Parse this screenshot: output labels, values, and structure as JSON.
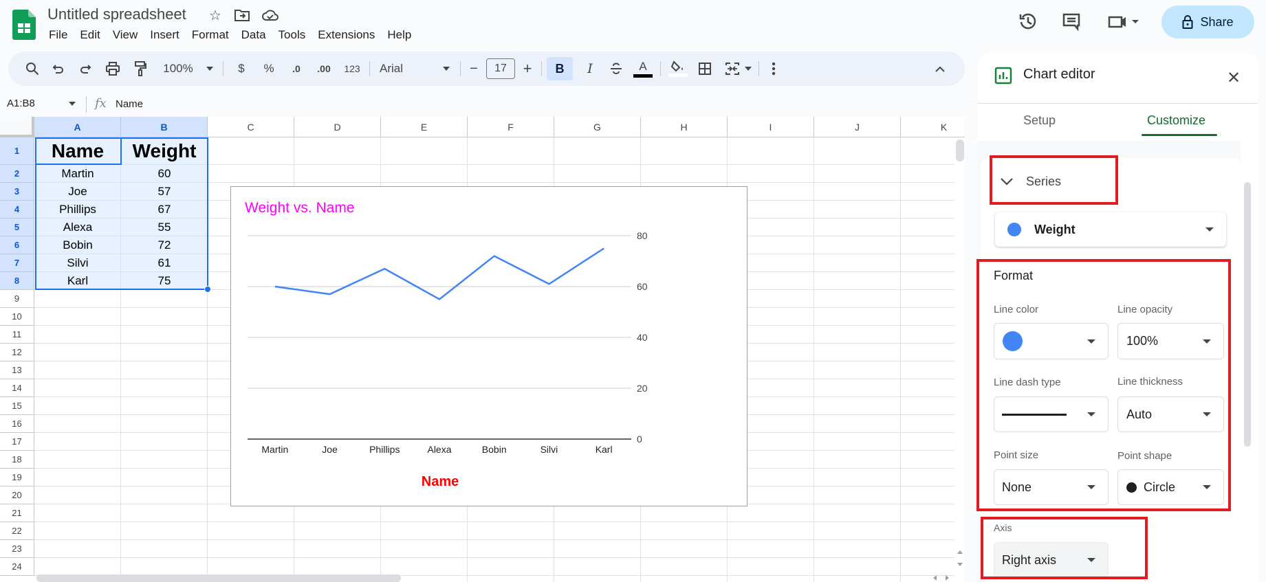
{
  "app": {
    "title": "Untitled spreadsheet",
    "brand_color": "#0f9d58",
    "menu": [
      "File",
      "Edit",
      "View",
      "Insert",
      "Format",
      "Data",
      "Tools",
      "Extensions",
      "Help"
    ],
    "share_label": "Share",
    "title_icons": [
      "star-icon",
      "move-to-folder-icon",
      "cloud-saved-icon"
    ],
    "header_icons": [
      "version-history-icon",
      "comments-icon",
      "meet-icon"
    ]
  },
  "toolbar": {
    "zoom": "100%",
    "currency": "$",
    "percent": "%",
    "decrease_decimal": ".0",
    "increase_decimal": ".00",
    "more_formats": "123",
    "font": "Arial",
    "font_size": "17",
    "decrement": "−",
    "increment": "+",
    "bold": "B",
    "italic": "I",
    "strikethrough": "S",
    "text_color": "A"
  },
  "formula_bar": {
    "name_box": "A1:B8",
    "fx": "fx",
    "content": "Name"
  },
  "sheet": {
    "columns": [
      "A",
      "B",
      "C",
      "D",
      "E",
      "F",
      "G",
      "H",
      "I",
      "J",
      "K"
    ],
    "rows": [
      "1",
      "2",
      "3",
      "4",
      "5",
      "6",
      "7",
      "8",
      "9",
      "10",
      "11",
      "12",
      "13",
      "14",
      "15",
      "16",
      "17",
      "18",
      "19",
      "20",
      "21",
      "22",
      "23",
      "24"
    ],
    "header": [
      "Name",
      "Weight"
    ],
    "data": [
      [
        "Martin",
        "60"
      ],
      [
        "Joe",
        "57"
      ],
      [
        "Phillips",
        "67"
      ],
      [
        "Alexa",
        "55"
      ],
      [
        "Bobin",
        "72"
      ],
      [
        "Silvi",
        "61"
      ],
      [
        "Karl",
        "75"
      ]
    ]
  },
  "chart_data": {
    "type": "line",
    "title": "Weight vs. Name",
    "title_color": "#ff00ff",
    "xlabel": "Name",
    "xlabel_color": "#ff0000",
    "ylabel": "",
    "categories": [
      "Martin",
      "Joe",
      "Phillips",
      "Alexa",
      "Bobin",
      "Silvi",
      "Karl"
    ],
    "series": [
      {
        "name": "Weight",
        "color": "#4285f4",
        "values": [
          60,
          57,
          67,
          55,
          72,
          61,
          75
        ]
      }
    ],
    "ylim": [
      0,
      80
    ],
    "yticks": [
      "0",
      "20",
      "40",
      "60",
      "80"
    ],
    "y_axis_side": "right",
    "grid": true,
    "legend": "none"
  },
  "chart_editor": {
    "title": "Chart editor",
    "tabs": [
      "Setup",
      "Customize"
    ],
    "active_tab": "Customize",
    "section": "Series",
    "series_selected": "Weight",
    "series_color": "#4285f4",
    "format_heading": "Format",
    "fields": {
      "line_color": {
        "label": "Line color",
        "value_color": "#4285f4"
      },
      "line_opacity": {
        "label": "Line opacity",
        "value": "100%"
      },
      "line_dash_type": {
        "label": "Line dash type",
        "value": "solid"
      },
      "line_thickness": {
        "label": "Line thickness",
        "value": "Auto"
      },
      "point_size": {
        "label": "Point size",
        "value": "None"
      },
      "point_shape": {
        "label": "Point shape",
        "value": "Circle"
      },
      "axis": {
        "label": "Axis",
        "value": "Right axis"
      }
    },
    "annotation_color": "#e21b23"
  }
}
